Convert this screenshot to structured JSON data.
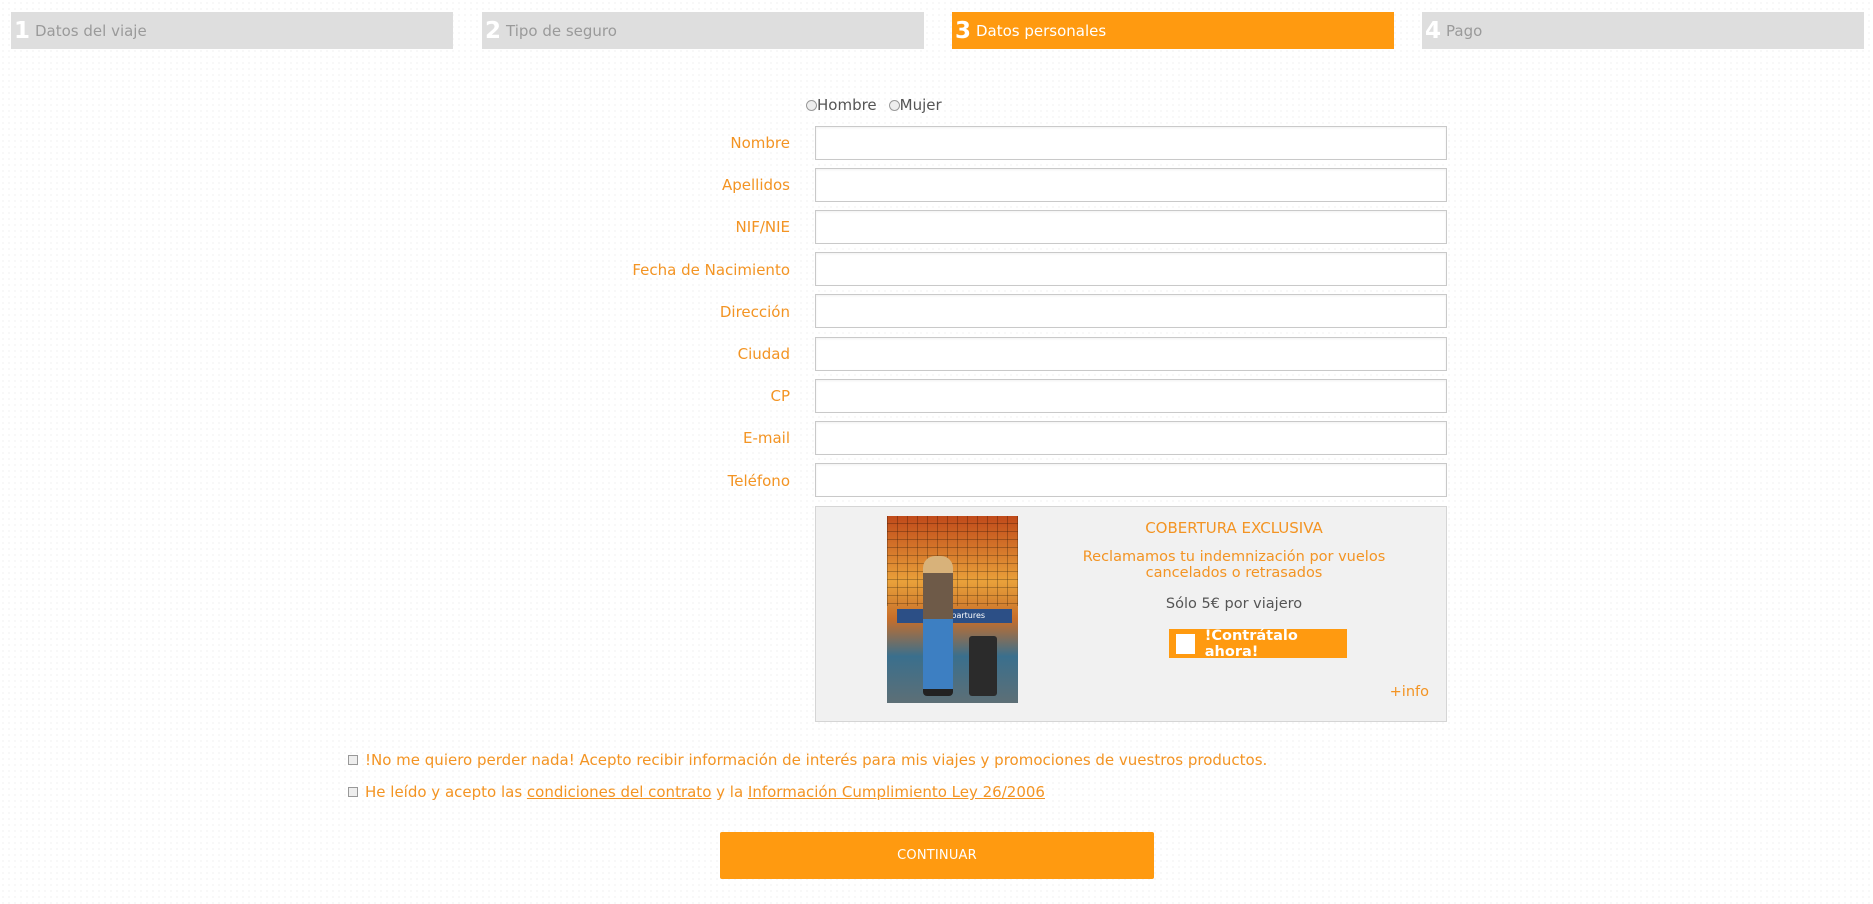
{
  "steps": [
    {
      "num": "1",
      "label": "Datos del viaje",
      "active": false
    },
    {
      "num": "2",
      "label": "Tipo de seguro",
      "active": false
    },
    {
      "num": "3",
      "label": "Datos personales",
      "active": true
    },
    {
      "num": "4",
      "label": "Pago",
      "active": false
    }
  ],
  "gender": {
    "options": [
      "Hombre",
      "Mujer"
    ]
  },
  "form": {
    "fields": [
      {
        "label": "Nombre",
        "value": ""
      },
      {
        "label": "Apellidos",
        "value": ""
      },
      {
        "label": "NIF/NIE",
        "value": ""
      },
      {
        "label": "Fecha de Nacimiento",
        "value": ""
      },
      {
        "label": "Dirección",
        "value": ""
      },
      {
        "label": "Ciudad",
        "value": ""
      },
      {
        "label": "CP",
        "value": ""
      },
      {
        "label": "E-mail",
        "value": ""
      },
      {
        "label": "Teléfono",
        "value": ""
      }
    ]
  },
  "promo": {
    "title": "COBERTURA EXCLUSIVA",
    "description": "Reclamamos tu indemnización por vuelos cancelados o retrasados",
    "price": "Sólo 5€ por viajero",
    "button_label": "!Contrátalo ahora!",
    "info_link": "+info",
    "photo_sign": "D... Departures"
  },
  "consent": {
    "newsletter": "!No me quiero perder nada! Acepto recibir información de interés para mis viajes y promociones de vuestros productos.",
    "terms_prefix": "He leído y acepto las ",
    "terms_link1": "condiciones del contrato",
    "terms_middle": " y la ",
    "terms_link2": "Información Cumplimiento Ley 26/2006"
  },
  "continue_label": "CONTINUAR",
  "colors": {
    "accent": "#ff9a10",
    "label": "#f39423",
    "step_inactive": "#dedede"
  }
}
